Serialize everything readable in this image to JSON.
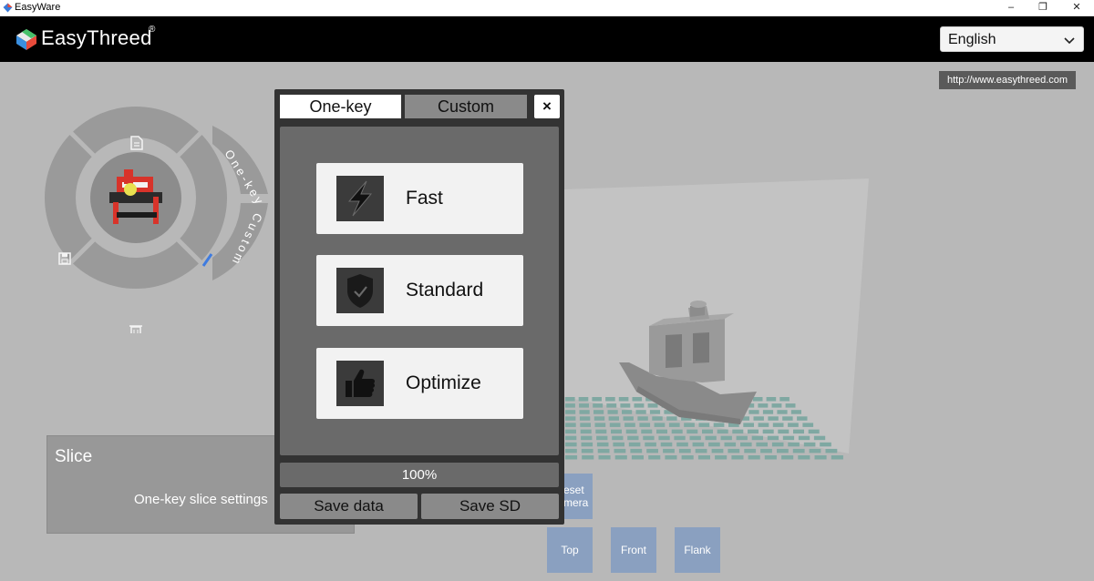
{
  "window": {
    "title": "EasyWare",
    "minimize": "–",
    "restore": "❐",
    "close": "✕"
  },
  "header": {
    "brand": "EasyThreed",
    "brand_mark": "®",
    "language": {
      "selected": "English"
    }
  },
  "workspace": {
    "url": "http://www.easythreed.com"
  },
  "radial_menu": {
    "tab_onekey": "One-key",
    "tab_custom": "Custom",
    "icons": [
      "file-icon",
      "save-icon",
      "trash-icon",
      "pen-icon"
    ]
  },
  "slice_panel": {
    "title": "Slice",
    "description": "One-key slice settings"
  },
  "camera": {
    "reset_line1": "eset",
    "reset_line2": "mera",
    "top": "Top",
    "front": "Front",
    "flank": "Flank"
  },
  "dialog": {
    "tabs": {
      "onekey": "One-key",
      "custom": "Custom"
    },
    "close": "×",
    "modes": [
      {
        "label": "Fast",
        "icon": "lightning-icon"
      },
      {
        "label": "Standard",
        "icon": "shield-check-icon"
      },
      {
        "label": "Optimize",
        "icon": "thumbs-up-icon"
      }
    ],
    "progress": {
      "label": "100%",
      "value": 100
    },
    "save_data": "Save data",
    "save_sd": "Save SD"
  },
  "colors": {
    "header_bg": "#000000",
    "workspace_bg": "#b8b8b8",
    "dialog_bg": "#333333",
    "panel_bg": "#6a6a6a",
    "tab_inactive": "#8a8a8a",
    "camera_btn": "#8aa0c0",
    "grid_tile": "#7fa8a2",
    "boat": "#8a8a8a",
    "printer_red": "#d8332a"
  }
}
